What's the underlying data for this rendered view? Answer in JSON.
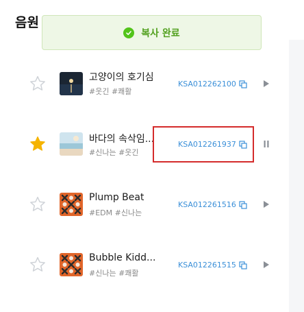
{
  "page": {
    "title": "음원"
  },
  "toast": {
    "text": "복사 완료",
    "color": "#52c41a"
  },
  "tracks": [
    {
      "title": "고양이의 호기심",
      "tags": "#웃긴 #쾌활",
      "code": "KSA012262100",
      "favorited": false,
      "state": "play",
      "cover_icon": "night-sea-cover"
    },
    {
      "title": "바다의 속삭임...",
      "tags": "#신나는 #웃긴",
      "code": "KSA012261937",
      "favorited": true,
      "state": "pause",
      "cover_icon": "beach-cover"
    },
    {
      "title": "Plump Beat",
      "tags": "#EDM #신나는",
      "code": "KSA012261516",
      "favorited": false,
      "state": "play",
      "cover_icon": "pattern-cover"
    },
    {
      "title": "Bubble Kidd...",
      "tags": "#신나는 #쾌활",
      "code": "KSA012261515",
      "favorited": false,
      "state": "play",
      "cover_icon": "pattern-cover"
    }
  ],
  "colors": {
    "accent": "#3a8fd8",
    "star_active": "#f5b400",
    "highlight": "#d42a2a"
  }
}
